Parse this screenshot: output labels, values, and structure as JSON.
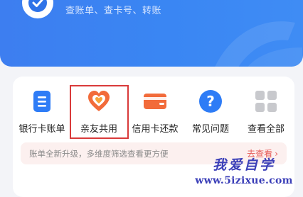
{
  "banner": {
    "subtitle": "查账单、查卡号、转账",
    "colors": {
      "background": "#3d7ef0",
      "text": "#d7e6ff"
    }
  },
  "services": [
    {
      "label": "银行卡账单",
      "icon": "document-list-icon"
    },
    {
      "label": "亲友共用",
      "icon": "family-heart-icon",
      "highlighted": true
    },
    {
      "label": "信用卡还款",
      "icon": "credit-card-icon"
    },
    {
      "label": "常见问题",
      "icon": "question-circle-icon"
    },
    {
      "label": "查看全部",
      "icon": "grid-icon"
    }
  ],
  "tip": {
    "text": "账单全新升级，多维度筛选查看更方便",
    "link": "去查看"
  },
  "site_watermark": {
    "name": "我爱自学",
    "url": "www.5izixue.com"
  },
  "colors": {
    "accent_blue": "#2e7cf6",
    "accent_orange": "#f26b3a",
    "highlight_red": "#d93a3a",
    "tip_bg": "#fcf0ef",
    "tip_link": "#e65a57"
  }
}
